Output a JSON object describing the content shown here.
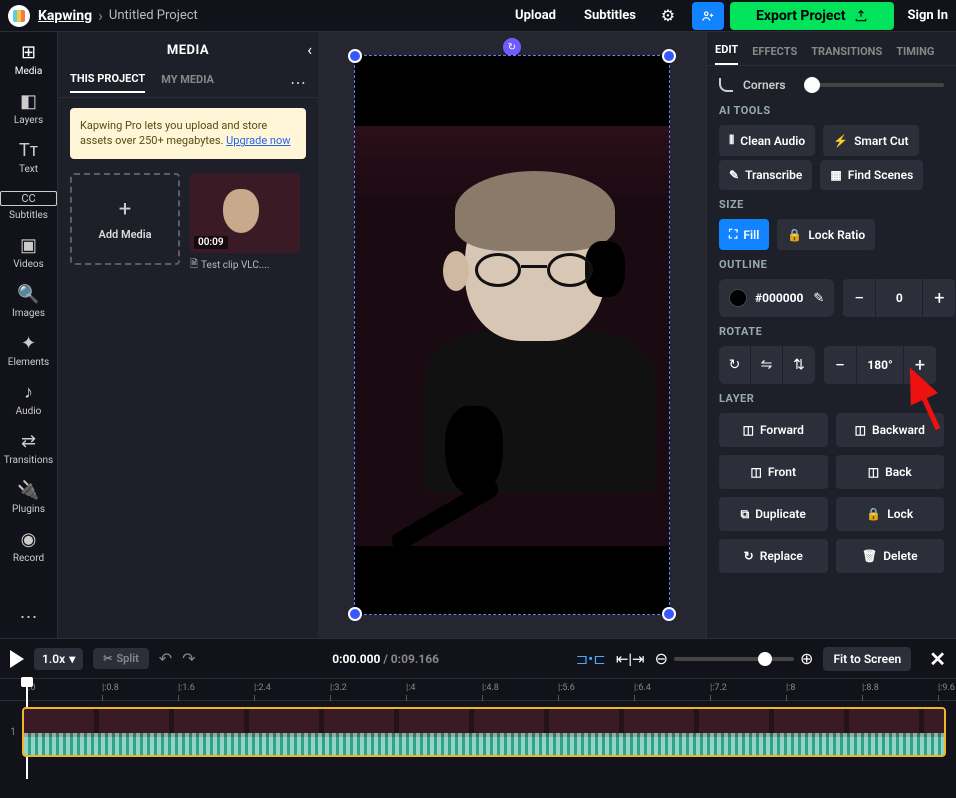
{
  "header": {
    "brand": "Kapwing",
    "project_name": "Untitled Project",
    "upload": "Upload",
    "subtitles": "Subtitles",
    "export": "Export Project",
    "sign_in": "Sign In"
  },
  "rail": [
    {
      "icon": "⊞",
      "label": "Media",
      "active": true
    },
    {
      "icon": "◧",
      "label": "Layers"
    },
    {
      "icon": "Tᴛ",
      "label": "Text"
    },
    {
      "icon": "CC",
      "label": "Subtitles"
    },
    {
      "icon": "▣",
      "label": "Videos"
    },
    {
      "icon": "🔍",
      "label": "Images"
    },
    {
      "icon": "✦",
      "label": "Elements"
    },
    {
      "icon": "♪",
      "label": "Audio"
    },
    {
      "icon": "⇄",
      "label": "Transitions"
    },
    {
      "icon": "🔌",
      "label": "Plugins"
    },
    {
      "icon": "◉",
      "label": "Record"
    }
  ],
  "media": {
    "title": "MEDIA",
    "tabs": {
      "this_project": "THIS PROJECT",
      "my_media": "MY MEDIA"
    },
    "promo_text": "Kapwing Pro lets you upload and store assets over 250+ megabytes. ",
    "promo_link": "Upgrade now",
    "add_label": "Add Media",
    "clip_duration": "00:09",
    "clip_name": "Test clip VLC...."
  },
  "prop_tabs": {
    "edit": "EDIT",
    "effects": "EFFECTS",
    "transitions": "TRANSITIONS",
    "timing": "TIMING"
  },
  "props": {
    "corners": "Corners",
    "ai_tools": "AI TOOLS",
    "clean_audio": "Clean Audio",
    "smart_cut": "Smart Cut",
    "transcribe": "Transcribe",
    "find_scenes": "Find Scenes",
    "size": "SIZE",
    "fill": "Fill",
    "lock_ratio": "Lock Ratio",
    "outline": "OUTLINE",
    "outline_hex": "#000000",
    "outline_val": "0",
    "rotate": "ROTATE",
    "rotate_val": "180°",
    "layer": "LAYER",
    "forward": "Forward",
    "backward": "Backward",
    "front": "Front",
    "back": "Back",
    "duplicate": "Duplicate",
    "lock": "Lock",
    "replace": "Replace",
    "delete": "Delete"
  },
  "timeline": {
    "speed": "1.0x",
    "split": "Split",
    "time_current": "0:00.000",
    "time_total": "0:09.166",
    "fit": "Fit to Screen",
    "track_num": "1",
    "ticks": [
      ":0",
      ":0.8",
      ":1.6",
      ":2.4",
      ":3.2",
      ":4",
      ":4.8",
      ":5.6",
      ":6.4",
      ":7.2",
      ":8",
      ":8.8",
      ":9.6"
    ]
  }
}
